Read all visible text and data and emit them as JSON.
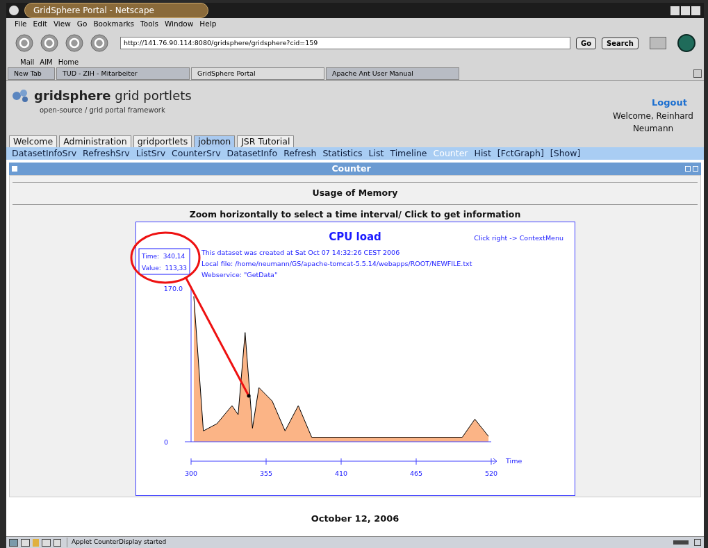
{
  "window": {
    "title": "GridSphere Portal - Netscape"
  },
  "menu_bar": [
    "File",
    "Edit",
    "View",
    "Go",
    "Bookmarks",
    "Tools",
    "Window",
    "Help"
  ],
  "toolbar": {
    "url": "http://141.76.90.114:8080/gridsphere/gridsphere?cid=159",
    "go": "Go",
    "search": "Search"
  },
  "personal_bar": [
    "Mail",
    "AIM",
    "Home"
  ],
  "browser_tabs": [
    {
      "label": "New Tab",
      "selected": false
    },
    {
      "label": "TUD - ZIH - Mitarbeiter",
      "selected": false
    },
    {
      "label": "GridSphere Portal",
      "selected": true
    },
    {
      "label": "Apache Ant User Manual",
      "selected": false
    }
  ],
  "portal": {
    "logo": "**gridsphere** grid portlets",
    "tagline": "open-source / grid portal framework",
    "logout": "Logout",
    "welcome": "Welcome, Reinhard Neumann",
    "tabs": [
      {
        "label": "Welcome",
        "selected": false
      },
      {
        "label": "Administration",
        "selected": false
      },
      {
        "label": "gridportlets",
        "selected": false
      },
      {
        "label": "jobmon",
        "selected": true
      },
      {
        "label": "JSR Tutorial",
        "selected": false
      }
    ],
    "subnav": [
      {
        "label": "DatasetInfoSrv",
        "selected": false
      },
      {
        "label": "RefreshSrv",
        "selected": false
      },
      {
        "label": "ListSrv",
        "selected": false
      },
      {
        "label": "CounterSrv",
        "selected": false
      },
      {
        "label": "DatasetInfo",
        "selected": false
      },
      {
        "label": "Refresh",
        "selected": false
      },
      {
        "label": "Statistics",
        "selected": false
      },
      {
        "label": "List",
        "selected": false
      },
      {
        "label": "Timeline",
        "selected": false
      },
      {
        "label": "Counter",
        "selected": true
      },
      {
        "label": "Hist",
        "selected": false
      },
      {
        "label": "[FctGraph]",
        "selected": false
      },
      {
        "label": "[Show]",
        "selected": false
      }
    ],
    "portlet": {
      "title": "Counter",
      "heading": "Usage of Memory",
      "instruction": "Zoom horizontally to select a time interval/ Click to get information",
      "applet": {
        "context_hint": "Click right -> ContextMenu",
        "info": [
          "This dataset was created at Sat Oct 07 14:32:26 CEST 2006",
          "Local file: /home/neumann/GS/apache-tomcat-5.5.14/webapps/ROOT/NEWFILE.txt",
          "Webservice: \"GetData\""
        ],
        "tooltip": [
          "Time:  340,14",
          "Value:  113,33"
        ],
        "chart_data": {
          "type": "area",
          "title": "CPU load",
          "xlabel": "Time",
          "xlim": [
            300,
            520
          ],
          "ylim": [
            0,
            170
          ],
          "xticks": [
            300,
            355,
            410,
            465,
            520
          ],
          "yticks": [
            0,
            {
              "value": 170,
              "label": "170.0"
            }
          ],
          "x": [
            302,
            309,
            319,
            330,
            334.5,
            339.6,
            345,
            349.7,
            359.5,
            368.9,
            378.6,
            388.4,
            498.8,
            508,
            518
          ],
          "series": [
            {
              "color": "#fbb486",
              "values": [
                161,
                12,
                20,
                40,
                30,
                121,
                15,
                60,
                45,
                12,
                40,
                5,
                5,
                25,
                6
              ]
            }
          ]
        }
      }
    },
    "date": "October 12, 2006"
  },
  "status_bar": {
    "text": "Applet CounterDisplay started"
  }
}
